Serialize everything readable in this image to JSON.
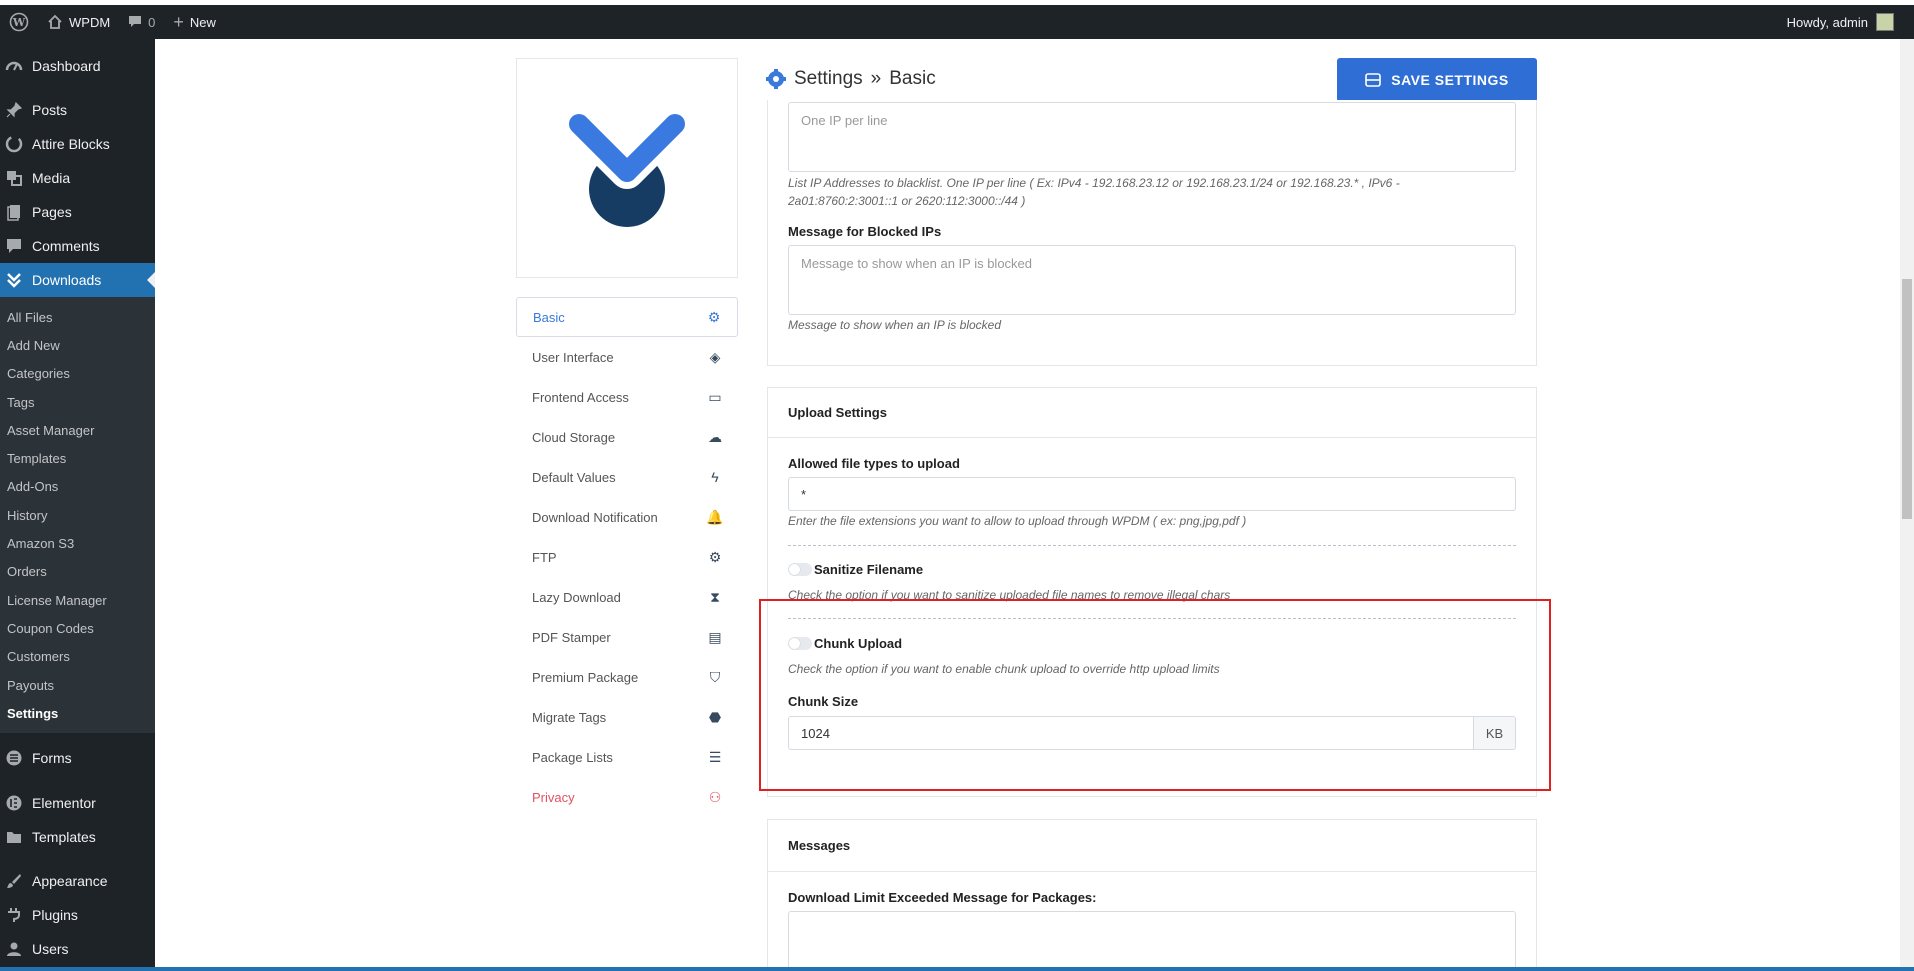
{
  "adminbar": {
    "site_name": "WPDM",
    "comments_count": "0",
    "new_label": "New",
    "howdy": "Howdy, admin"
  },
  "sidebar": {
    "items_top": [
      {
        "label": "Dashboard",
        "icon": "dashboard-icon"
      },
      {
        "label": "Posts",
        "icon": "pin-icon"
      },
      {
        "label": "Attire Blocks",
        "icon": "blocks-icon"
      },
      {
        "label": "Media",
        "icon": "media-icon"
      },
      {
        "label": "Pages",
        "icon": "pages-icon"
      },
      {
        "label": "Comments",
        "icon": "comments-icon"
      },
      {
        "label": "Downloads",
        "icon": "downloads-icon"
      }
    ],
    "submenu": [
      "All Files",
      "Add New",
      "Categories",
      "Tags",
      "Asset Manager",
      "Templates",
      "Add-Ons",
      "History",
      "Amazon S3",
      "Orders",
      "License Manager",
      "Coupon Codes",
      "Customers",
      "Payouts",
      "Settings"
    ],
    "items_bottom": [
      {
        "label": "Forms",
        "icon": "forms-icon"
      },
      {
        "label": "Elementor",
        "icon": "elementor-icon"
      },
      {
        "label": "Templates",
        "icon": "folder-icon"
      },
      {
        "label": "Appearance",
        "icon": "brush-icon"
      },
      {
        "label": "Plugins",
        "icon": "plugin-icon"
      },
      {
        "label": "Users",
        "icon": "user-icon"
      }
    ]
  },
  "settings_nav": [
    {
      "label": "Basic",
      "icon": "⚙"
    },
    {
      "label": "User Interface",
      "icon": "◈"
    },
    {
      "label": "Frontend Access",
      "icon": "▭"
    },
    {
      "label": "Cloud Storage",
      "icon": "☁"
    },
    {
      "label": "Default Values",
      "icon": "ϟ"
    },
    {
      "label": "Download Notification",
      "icon": "🔔"
    },
    {
      "label": "FTP",
      "icon": "⚙"
    },
    {
      "label": "Lazy Download",
      "icon": "⧗"
    },
    {
      "label": "PDF Stamper",
      "icon": "▤"
    },
    {
      "label": "Premium Package",
      "icon": "⛉"
    },
    {
      "label": "Migrate Tags",
      "icon": "⬣"
    },
    {
      "label": "Package Lists",
      "icon": "☰"
    },
    {
      "label": "Privacy",
      "icon": "⚇"
    }
  ],
  "header": {
    "title": "Settings",
    "separator": "»",
    "subtitle": "Basic",
    "save_label": "SAVE SETTINGS"
  },
  "ip_block": {
    "blacklist_placeholder": "One IP per line",
    "blacklist_hint_1": "List IP Addresses to blacklist. One IP per line ( Ex: IPv4 - 192.168.23.12 or 192.168.23.1/24 or 192.168.23.* , IPv6 -",
    "blacklist_hint_2": "2a01:8760:2:3001::1 or 2620:112:3000::/44 )",
    "message_label": "Message for Blocked IPs",
    "message_placeholder": "Message to show when an IP is blocked",
    "message_hint": "Message to show when an IP is blocked"
  },
  "upload": {
    "heading": "Upload Settings",
    "types_label": "Allowed file types to upload",
    "types_value": "*",
    "types_hint": "Enter the file extensions you want to allow to upload through WPDM ( ex: png,jpg,pdf )",
    "sanitize_label": "Sanitize Filename",
    "sanitize_on": false,
    "sanitize_hint": "Check the option if you want to sanitize uploaded file names to remove illegal chars",
    "chunk_label": "Chunk Upload",
    "chunk_on": false,
    "chunk_hint": "Check the option if you want to enable chunk upload to override http upload limits",
    "chunk_size_label": "Chunk Size",
    "chunk_size_value": "1024",
    "chunk_size_unit": "KB"
  },
  "messages": {
    "heading": "Messages",
    "limit_label": "Download Limit Exceeded Message for Packages:"
  },
  "colors": {
    "accent": "#2f6ed4",
    "wp_admin": "#1d2327",
    "highlight": "#e02020"
  }
}
